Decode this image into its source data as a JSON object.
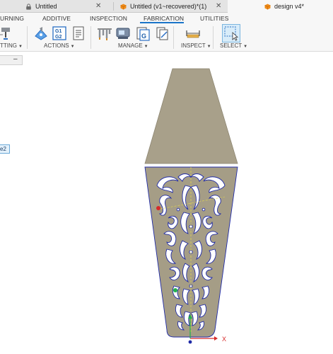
{
  "tabs": [
    {
      "label": "Untitled",
      "active": false
    },
    {
      "label": "Untitled (v1~recovered)*(1)",
      "active": false
    },
    {
      "label": "design v4*",
      "active": true
    }
  ],
  "workspace_tabs": [
    "URNING",
    "ADDITIVE",
    "INSPECTION",
    "FABRICATION",
    "UTILITIES"
  ],
  "active_workspace": "FABRICATION",
  "groups": {
    "cutting": "TTING",
    "actions": "ACTIONS",
    "manage": "MANAGE",
    "inspect": "INSPECT",
    "select": "SELECT"
  },
  "browser": {
    "collapse_symbol": "–",
    "chip_label": "e2"
  },
  "axis": {
    "x_label": "X"
  },
  "colors": {
    "accent": "#1b75c9",
    "part_fill": "#a8a08a",
    "part_fill_lower": "#a59d86",
    "cut_line": "#1f2aa6",
    "axis_x": "#d62a2a",
    "axis_y": "#22b14c",
    "tab_icon": "#f08c1a"
  },
  "icons": [
    "lock-icon",
    "cube-icon",
    "cube-icon",
    "caret-down-icon"
  ]
}
